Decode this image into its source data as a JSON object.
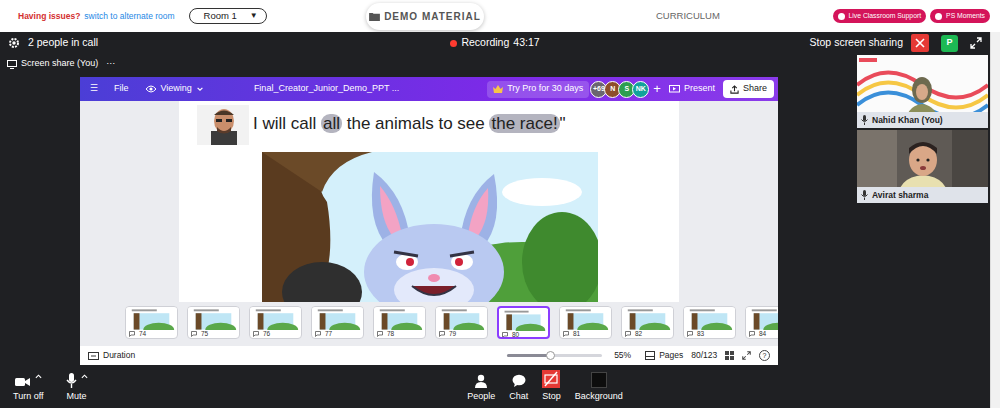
{
  "top_bar": {
    "issue": "Having issues?",
    "switch_room": "switch to alternate room",
    "room": "Room 1",
    "room_caret": "▼",
    "material": "DEMO MATERIAL",
    "curriculum": "CURRICULUM",
    "buttons": [
      "Live Classroom Support",
      "PS Moments"
    ]
  },
  "call": {
    "people": "2 people in call",
    "recording": {
      "label": "Recording",
      "time": "43:17",
      "on": true
    },
    "stop_sharing": "Stop screen sharing",
    "avatar": "P",
    "share_label": "Screen share (You)",
    "share_more": "···"
  },
  "canva": {
    "menu": "☰",
    "file": "File",
    "viewing": "Viewing",
    "title": "Final_Creator_Junior_Demo_PPT ...",
    "pro": "Try Pro for 30 days",
    "collaborators": [
      {
        "label": "+69",
        "color": "#6b6570"
      },
      {
        "label": "N",
        "color": "#8d4e2c"
      },
      {
        "label": "S",
        "color": "#2e9e4f"
      },
      {
        "label": "NK",
        "color": "#12a29b"
      }
    ],
    "add": "+",
    "present": "Present",
    "share": "Share",
    "slide": {
      "segments": [
        {
          "text": "I will call ",
          "highlight": false
        },
        {
          "text": "all",
          "highlight": true
        },
        {
          "text": " the animals to see ",
          "highlight": false
        },
        {
          "text": "the race!",
          "highlight": true
        },
        {
          "text": "\"",
          "highlight": false
        }
      ]
    },
    "thumbnails": [
      {
        "number": "74",
        "selected": false
      },
      {
        "number": "75",
        "selected": false
      },
      {
        "number": "76",
        "selected": false
      },
      {
        "number": "77",
        "selected": false
      },
      {
        "number": "78",
        "selected": false
      },
      {
        "number": "79",
        "selected": false
      },
      {
        "number": "80",
        "selected": true
      },
      {
        "number": "81",
        "selected": false
      },
      {
        "number": "82",
        "selected": false
      },
      {
        "number": "83",
        "selected": false
      },
      {
        "number": "84",
        "selected": false
      }
    ],
    "duration": "Duration",
    "zoom": {
      "level": 0.45,
      "reading": "55%"
    },
    "pages_label": "Pages",
    "page_count": "80/123",
    "help": "?"
  },
  "participants": [
    {
      "name": "Nahid Khan (You)"
    },
    {
      "name": "Avirat sharma"
    }
  ],
  "controls": [
    {
      "label": "Turn off",
      "kind": "camera",
      "has_menu": true
    },
    {
      "label": "Mute",
      "kind": "mic",
      "has_menu": true
    },
    {
      "label": "People",
      "kind": "people",
      "has_menu": false
    },
    {
      "label": "Chat",
      "kind": "chat",
      "has_menu": false
    },
    {
      "label": "Stop",
      "kind": "stop",
      "has_menu": false
    },
    {
      "label": "Background",
      "kind": "background",
      "has_menu": false
    }
  ]
}
